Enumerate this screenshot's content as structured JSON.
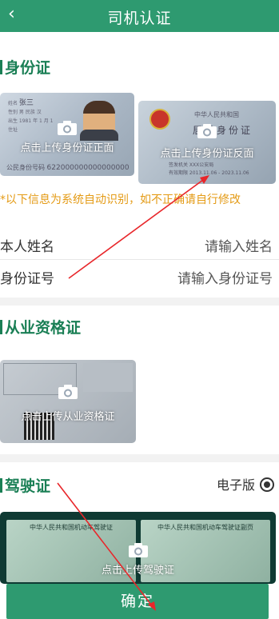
{
  "header": {
    "title": "司机认证",
    "back_icon": "chevron-left-icon"
  },
  "id_section": {
    "title": "身份证",
    "front_caption": "点击上传身份证正面",
    "back_caption": "点击上传身份证反面",
    "front_sample_name": "张三",
    "front_sample_number": "622000000000000000",
    "back_sample_country": "中华人民共和国",
    "back_sample_title": "居民身份证",
    "back_sample_authority": "XXX公安局",
    "back_sample_validity": "2013.11.06 - 2023.11.06"
  },
  "notice": "*以下信息为系统自动识别，如不正确请自行修改",
  "form": {
    "name_label": "本人姓名",
    "name_placeholder": "请输入姓名",
    "idno_label": "身份证号",
    "idno_placeholder": "请输入身份证号"
  },
  "qualification_section": {
    "title": "从业资格证",
    "caption": "点击上传从业资格证"
  },
  "license_section": {
    "title": "驾驶证",
    "electronic_label": "电子版",
    "caption": "点击上传驾驶证",
    "left_card_title": "中华人民共和国机动车驾驶证",
    "right_card_title": "中华人民共和国机动车驾驶证副页"
  },
  "confirm_label": "确定",
  "colors": {
    "primary": "#2e9a70",
    "section_title": "#1a7f55",
    "notice": "#e49b16",
    "annotation_arrow": "#e8262a"
  }
}
